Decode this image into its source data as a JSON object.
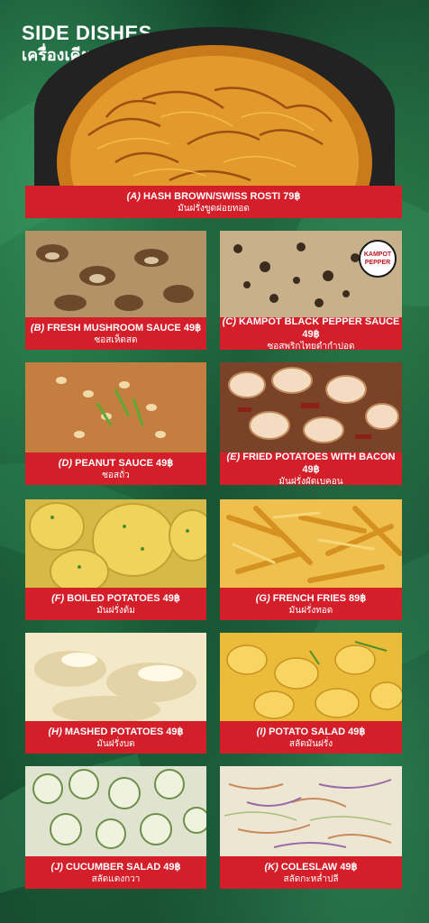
{
  "header": {
    "title": "SIDE DISHES",
    "subtitle": "เครื่องเคียง"
  },
  "items": [
    {
      "code": "(A)",
      "name": "HASH BROWN/SWISS ROSTI",
      "price": "79฿",
      "thai": "มันฝรั่งขูดฝอยทอด",
      "food": "hash-brown"
    },
    {
      "code": "(B)",
      "name": "FRESH MUSHROOM SAUCE",
      "price": "49฿",
      "thai": "ซอสเห็ดสด",
      "food": "mushroom-sauce"
    },
    {
      "code": "(C)",
      "name": "KAMPOT BLACK PEPPER SAUCE",
      "price": "49฿",
      "thai": "ซอสพริกไทยดำกำปอด",
      "food": "pepper-sauce"
    },
    {
      "code": "(D)",
      "name": "PEANUT SAUCE",
      "price": "49฿",
      "thai": "ซอสถั่ว",
      "food": "peanut-sauce"
    },
    {
      "code": "(E)",
      "name": "FRIED POTATOES WITH BACON",
      "price": "49฿",
      "thai": "มันฝรั่งผัดเบคอน",
      "food": "fried-potatoes"
    },
    {
      "code": "(F)",
      "name": "BOILED POTATOES",
      "price": "49฿",
      "thai": "มันฝรั่งต้ม",
      "food": "boiled-potatoes"
    },
    {
      "code": "(G)",
      "name": "FRENCH FRIES",
      "price": "89฿",
      "thai": "มันฝรั่งทอด",
      "food": "french-fries"
    },
    {
      "code": "(H)",
      "name": "MASHED POTATOES",
      "price": "49฿",
      "thai": "มันฝรั่งบด",
      "food": "mashed-potatoes"
    },
    {
      "code": "(I)",
      "name": "POTATO SALAD",
      "price": "49฿",
      "thai": "สลัดมันฝรั่ง",
      "food": "potato-salad"
    },
    {
      "code": "(J)",
      "name": "CUCUMBER SALAD",
      "price": "49฿",
      "thai": "สลัดแตงกวา",
      "food": "cucumber-salad"
    },
    {
      "code": "(K)",
      "name": "COLESLAW",
      "price": "49฿",
      "thai": "สลัดกะหล่ำปลี",
      "food": "coleslaw"
    }
  ],
  "stamp": {
    "line1": "KAMPOT",
    "line2": "PEPPER"
  },
  "colors": {
    "label_red": "#d41f2b",
    "background_green": "#1b5a37"
  }
}
